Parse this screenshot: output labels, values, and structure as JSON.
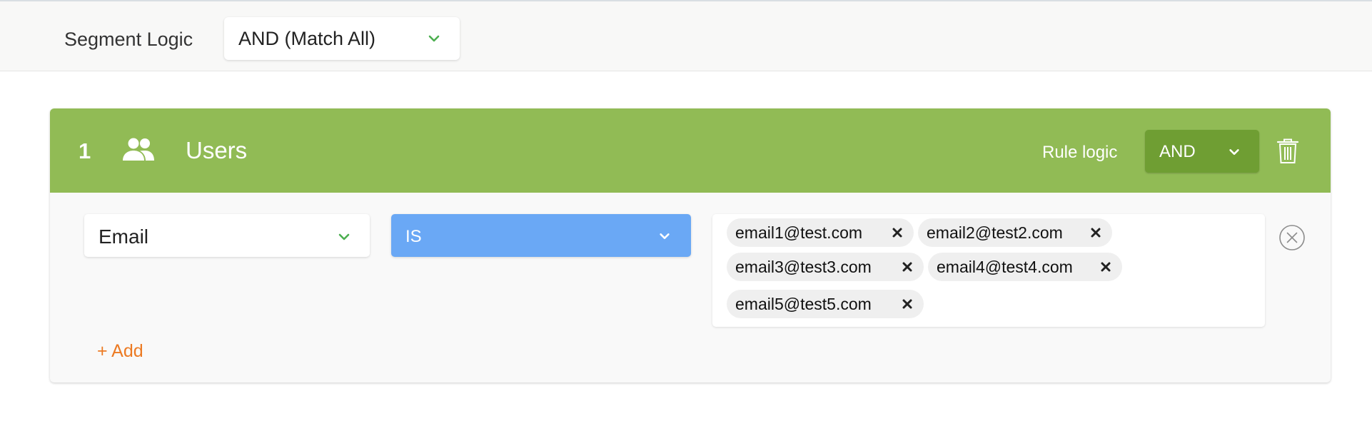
{
  "segment": {
    "logic_label": "Segment Logic",
    "logic_value": "AND (Match All)"
  },
  "rule": {
    "number": "1",
    "title": "Users",
    "logic_label": "Rule logic",
    "logic_value": "AND",
    "field": "Email",
    "operator": "IS",
    "values": [
      "email1@test.com",
      "email2@test2.com",
      "email3@test3.com",
      "email4@test4.com",
      "email5@test5.com"
    ],
    "add_label": "+ Add"
  },
  "colors": {
    "header_green": "#91bb55",
    "button_dark_green": "#6f9e33",
    "chevron_green": "#4caf50",
    "operator_blue": "#6aa8f5",
    "add_orange": "#ec7a23"
  },
  "icons": {
    "rule_type": "users-icon",
    "delete_rule": "trash-icon",
    "remove_condition": "close-circle-icon",
    "remove_chip": "close-icon",
    "dropdown": "chevron-down-icon"
  }
}
